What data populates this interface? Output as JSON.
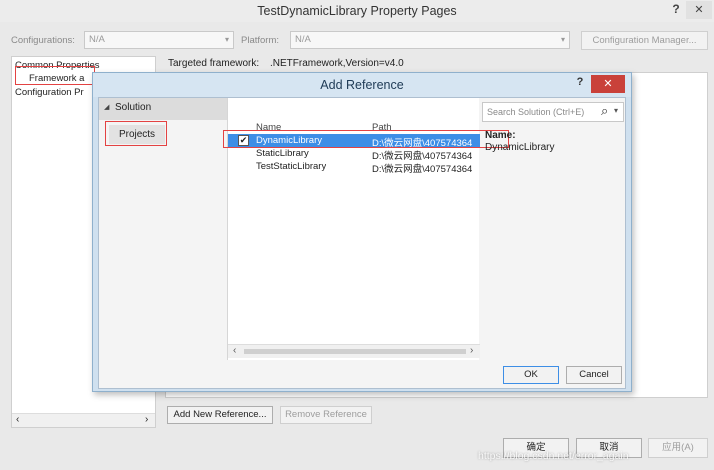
{
  "window": {
    "title": "TestDynamicLibrary Property Pages",
    "help_glyph": "?",
    "close_glyph": "✕"
  },
  "toolbar": {
    "configurations_label": "Configurations:",
    "configurations_value": "N/A",
    "platform_label": "Platform:",
    "platform_value": "N/A",
    "config_manager_label": "Configuration Manager..."
  },
  "tree": {
    "items": [
      "Common Properties",
      "Framework a",
      "Configuration Pr"
    ]
  },
  "main": {
    "targeted_framework_label": "Targeted framework:",
    "targeted_framework_value": ".NETFramework,Version=v4.0",
    "add_new_reference_label": "Add New Reference...",
    "remove_reference_label": "Remove Reference"
  },
  "footer": {
    "ok_label": "确定",
    "cancel_label": "取消",
    "apply_label": "应用(A)",
    "watermark": "https://blog.csdn.net/error_again"
  },
  "dialog": {
    "title": "Add Reference",
    "help_glyph": "?",
    "close_glyph": "✕",
    "nav_section": "Solution",
    "nav_item": "Projects",
    "search_placeholder": "Search Solution (Ctrl+E)",
    "columns": {
      "name": "Name",
      "path": "Path"
    },
    "rows": [
      {
        "name": "DynamicLibrary",
        "path": "D:\\微云网盘\\407574364",
        "checked": true,
        "selected": true
      },
      {
        "name": "StaticLibrary",
        "path": "D:\\微云网盘\\407574364",
        "checked": false,
        "selected": false
      },
      {
        "name": "TestStaticLibrary",
        "path": "D:\\微云网盘\\407574364",
        "checked": false,
        "selected": false
      }
    ],
    "details": {
      "name_label": "Name:",
      "name_value": "DynamicLibrary"
    },
    "ok_label": "OK",
    "cancel_label": "Cancel"
  },
  "icons": {
    "dropdown": "▾",
    "search": "⌕",
    "collapse": "◢",
    "scroll_left": "‹",
    "scroll_right": "›",
    "check": "✔"
  }
}
